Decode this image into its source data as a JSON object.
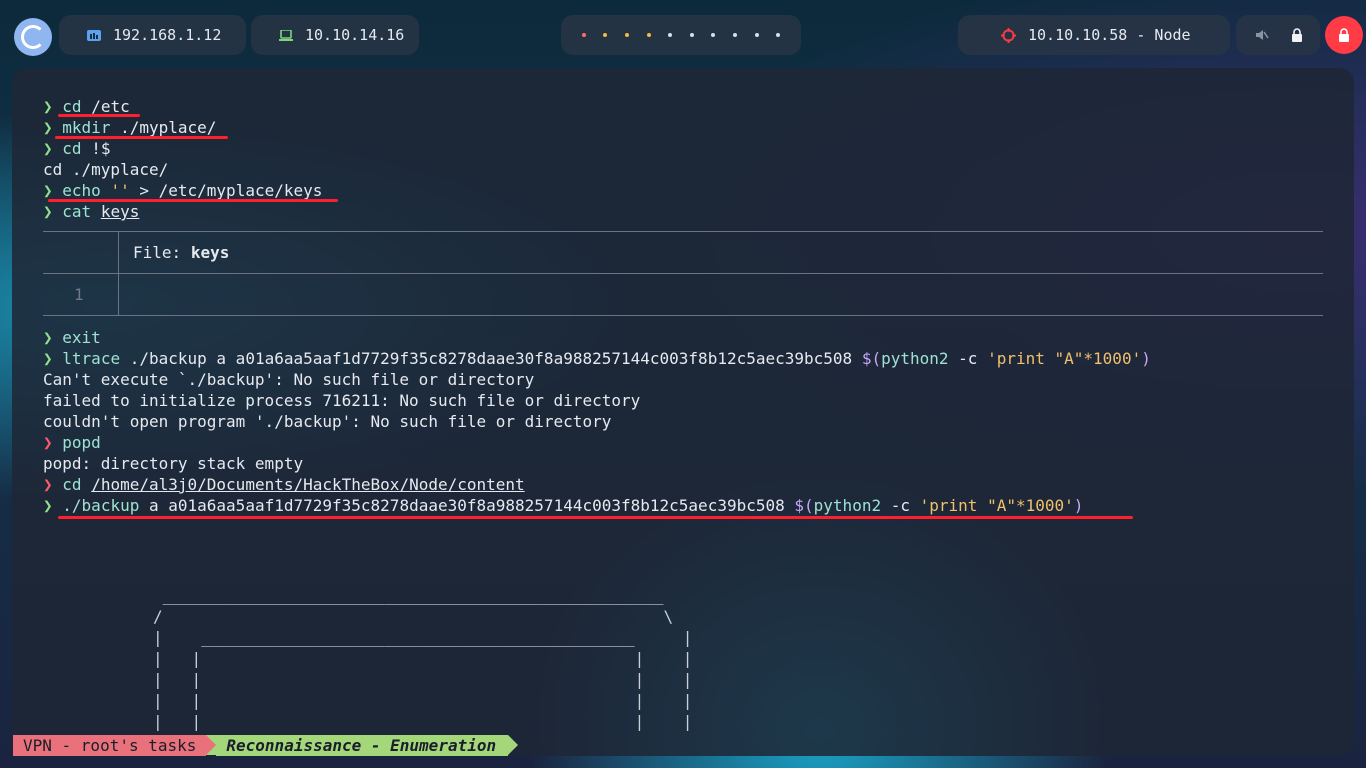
{
  "topbar": {
    "workspace_ip": "192.168.1.12",
    "vpn_ip": "10.10.14.16",
    "target": "10.10.10.58 - Node",
    "dots": [
      {
        "color": "#ff6b6b"
      },
      {
        "color": "#f4b942"
      },
      {
        "color": "#f4b942"
      },
      {
        "color": "#f4b942"
      },
      {
        "color": "#d8dde6"
      },
      {
        "color": "#d8dde6"
      },
      {
        "color": "#d8dde6"
      },
      {
        "color": "#d8dde6"
      },
      {
        "color": "#d8dde6"
      },
      {
        "color": "#d8dde6"
      }
    ],
    "power_color": "#ff3b45"
  },
  "terminal": {
    "prompt_symbol": "❯",
    "l1_cmd": "cd",
    "l1_arg": "/etc",
    "l2_cmd": "mkdir",
    "l2_arg": "./myplace/",
    "l3_cmd": "cd",
    "l3_arg": "!$",
    "l4_out": "cd ./myplace/",
    "l5_cmd": "echo",
    "l5_str": "''",
    "l5_rest": "> /etc/myplace/keys",
    "l6_cmd": "cat",
    "l6_arg": "keys",
    "bat_file_label": "File:",
    "bat_file_name": "keys",
    "bat_line_number": "1",
    "l7_cmd": "exit",
    "l8_cmd": "ltrace",
    "l8_args": "./backup a a01a6aa5aaf1d7729f35c8278daae30f8a988257144c003f8b12c5aec39bc508",
    "l8_dollar": "$(",
    "l8_py": "python2",
    "l8_flag": "-c",
    "l8_str": "'print \"A\"*1000'",
    "l8_close": ")",
    "o1": "Can't execute `./backup': No such file or directory",
    "o2": "failed to initialize process 716211: No such file or directory",
    "o3": "couldn't open program './backup': No such file or directory",
    "l9_cmd": "popd",
    "o4": "popd: directory stack empty",
    "l10_cmd": "cd",
    "l10_arg": "/home/al3j0/Documents/HackTheBox/Node/content",
    "l11_cmd": "./backup",
    "l11_args": "a a01a6aa5aaf1d7729f35c8278daae30f8a988257144c003f8b12c5aec39bc508",
    "l11_dollar": "$(",
    "l11_py": "python2",
    "l11_flag": "-c",
    "l11_str": "'print \"A\"*1000'",
    "l11_close": ")",
    "ascii_art": " ____________________________________________________\n/                                                    \\\n|    _____________________________________________     |\n|   |                                             |    |\n|   |                                             |    |\n|   |                                             |    |\n|   |                                             |    |"
  },
  "statusbar": {
    "session": "VPN - root's tasks",
    "window": "Reconnaissance - Enumeration"
  }
}
